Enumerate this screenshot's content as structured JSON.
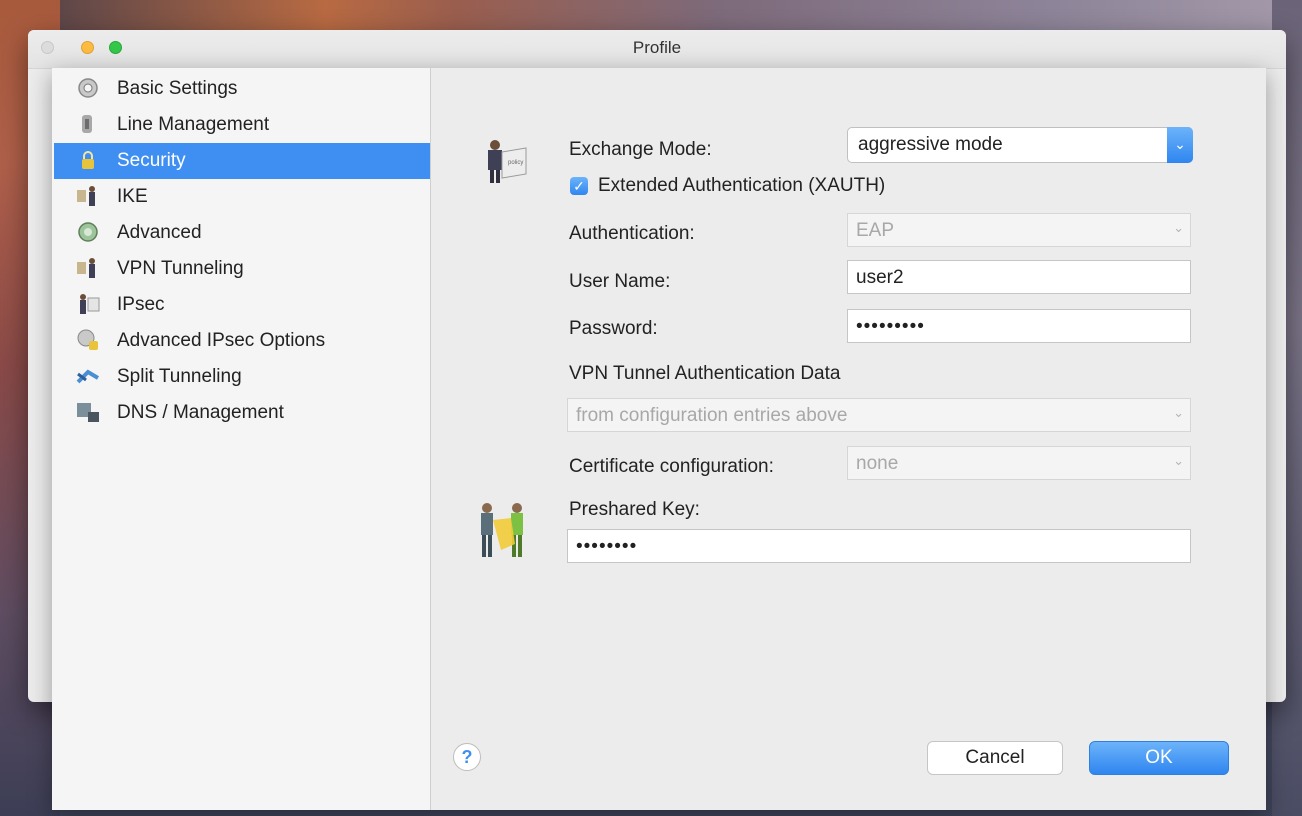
{
  "window": {
    "title": "Profile"
  },
  "sidebar": {
    "items": [
      {
        "label": "Basic Settings",
        "icon": "gear-icon",
        "selected": false
      },
      {
        "label": "Line Management",
        "icon": "line-management-icon",
        "selected": false
      },
      {
        "label": "Security",
        "icon": "lock-icon",
        "selected": true
      },
      {
        "label": "IKE",
        "icon": "ike-icon",
        "selected": false
      },
      {
        "label": "Advanced",
        "icon": "advanced-gear-icon",
        "selected": false
      },
      {
        "label": "VPN Tunneling",
        "icon": "vpn-tunnel-icon",
        "selected": false
      },
      {
        "label": "IPsec",
        "icon": "ipsec-icon",
        "selected": false
      },
      {
        "label": "Advanced IPsec Options",
        "icon": "ipsec-options-icon",
        "selected": false
      },
      {
        "label": "Split Tunneling",
        "icon": "split-tunnel-icon",
        "selected": false
      },
      {
        "label": "DNS / Management",
        "icon": "dns-icon",
        "selected": false
      }
    ]
  },
  "security": {
    "exchange_mode_label": "Exchange Mode:",
    "exchange_mode_value": "aggressive mode",
    "xauth_label": "Extended Authentication (XAUTH)",
    "xauth_checked": true,
    "authentication_label": "Authentication:",
    "authentication_value": "EAP",
    "username_label": "User Name:",
    "username_value": "user2",
    "password_label": "Password:",
    "password_value": "•••••••••",
    "vpn_auth_heading": "VPN Tunnel Authentication Data",
    "vpn_auth_value": "from configuration entries above",
    "cert_config_label": "Certificate configuration:",
    "cert_config_value": "none",
    "preshared_label": "Preshared Key:",
    "preshared_value": "••••••••"
  },
  "buttons": {
    "help": "?",
    "cancel": "Cancel",
    "ok": "OK"
  },
  "colors": {
    "accent": "#3f8ff2",
    "selected_row": "#3f8ff2"
  }
}
